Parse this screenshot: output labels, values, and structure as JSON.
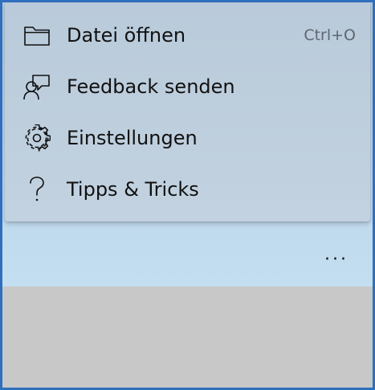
{
  "menu": {
    "items": [
      {
        "label": "Datei öffnen",
        "shortcut": "Ctrl+O",
        "icon": "folder-icon"
      },
      {
        "label": "Feedback senden",
        "shortcut": "",
        "icon": "feedback-icon"
      },
      {
        "label": "Einstellungen",
        "shortcut": "",
        "icon": "gear-icon"
      },
      {
        "label": "Tipps & Tricks",
        "shortcut": "",
        "icon": "help-icon"
      }
    ]
  },
  "toolbar": {
    "more_label": "···"
  },
  "colors": {
    "window_border": "#2f6fbd",
    "menu_background": "#bfcfdd",
    "lower_area": "#c8c8c8"
  }
}
